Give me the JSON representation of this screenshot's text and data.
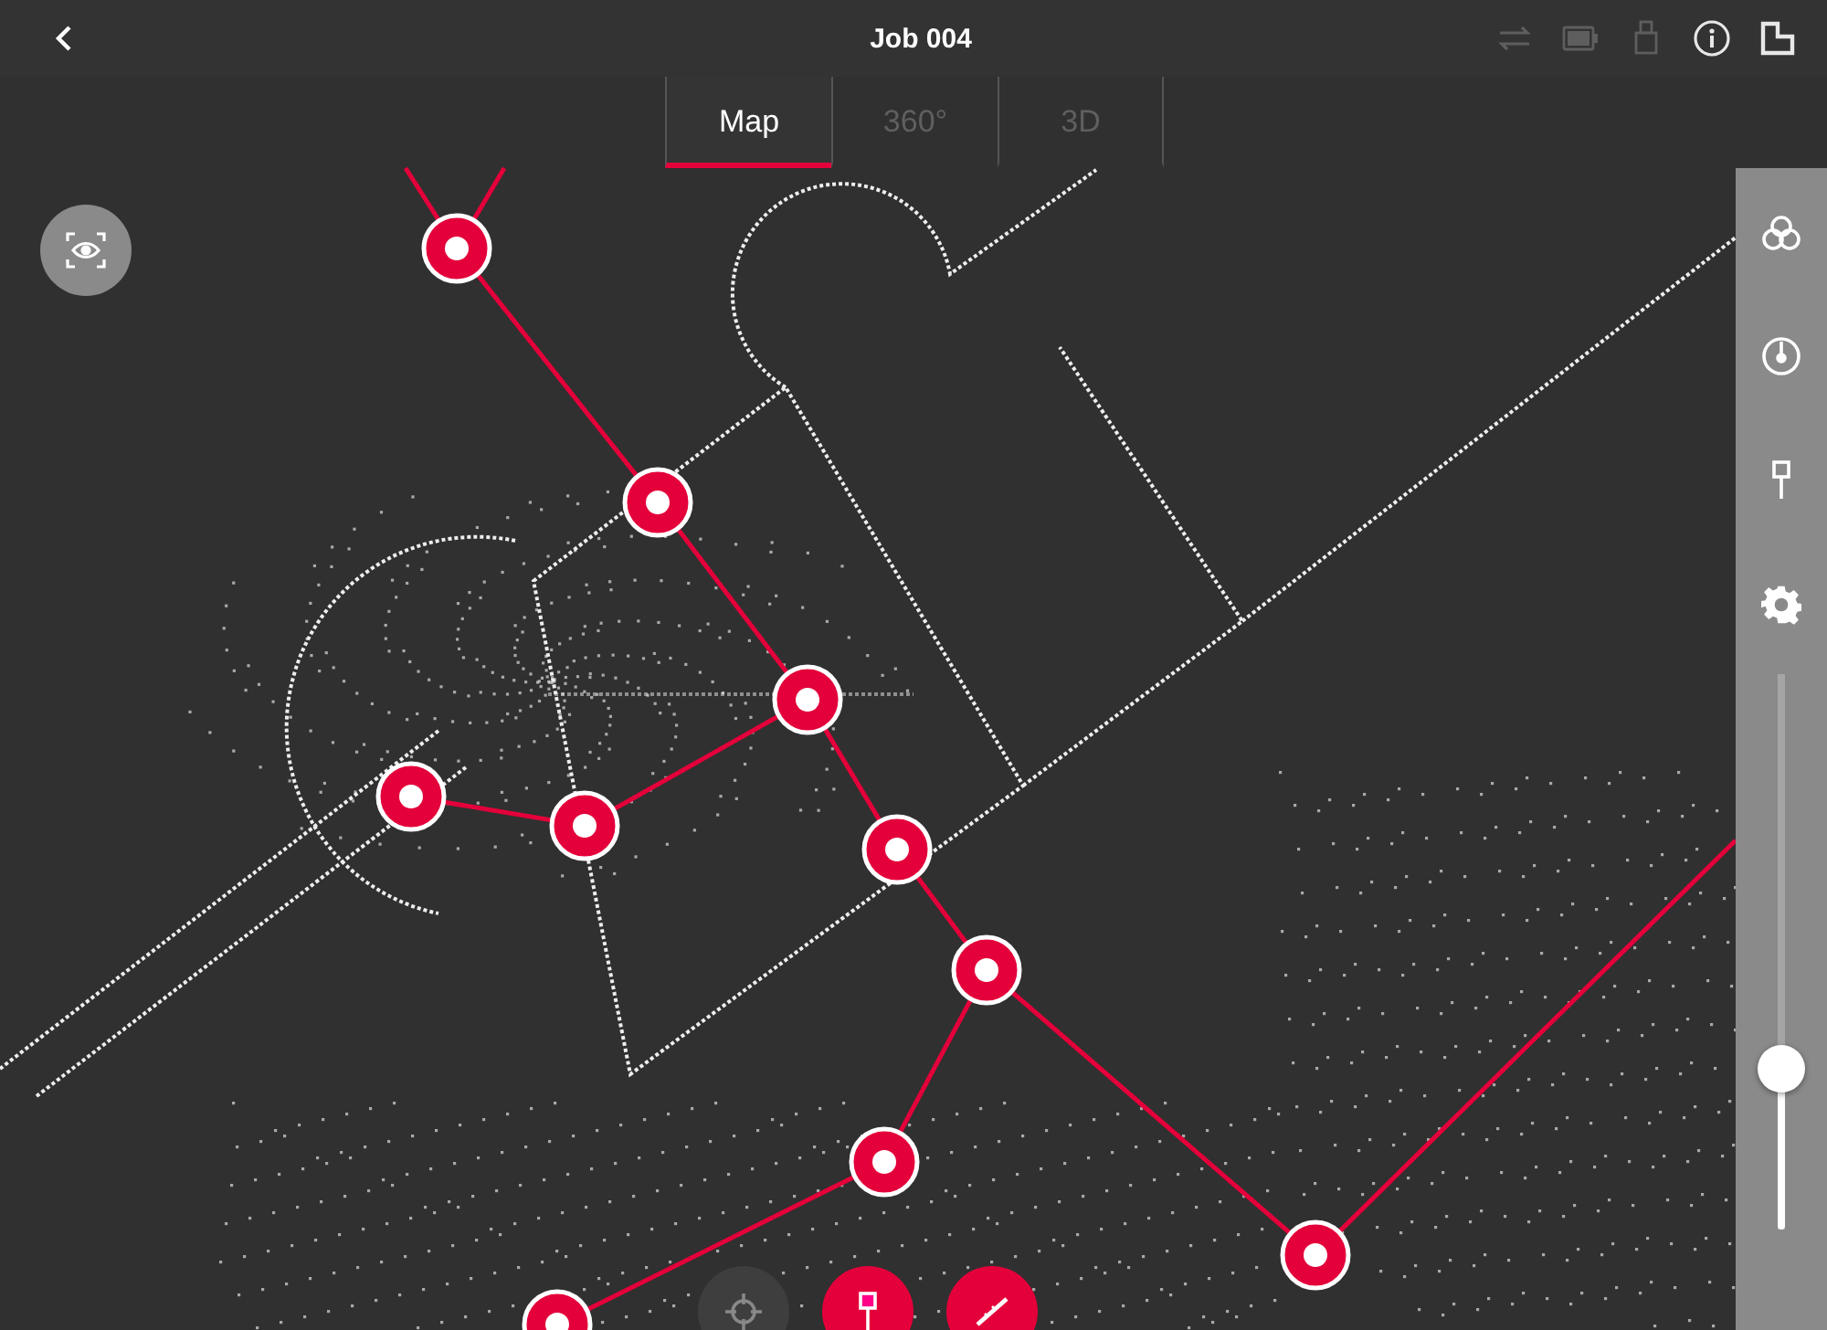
{
  "header": {
    "title": "Job 004",
    "icons": [
      {
        "kind": "sync",
        "active": false
      },
      {
        "kind": "battery",
        "active": false
      },
      {
        "kind": "usb",
        "active": false
      },
      {
        "kind": "info",
        "active": true
      },
      {
        "kind": "floorplan",
        "active": true
      }
    ]
  },
  "tabs": [
    {
      "label": "Map",
      "selected": true
    },
    {
      "label": "360°",
      "selected": false
    },
    {
      "label": "3D",
      "selected": false
    }
  ],
  "sidebar": {
    "tools": [
      {
        "kind": "layers"
      },
      {
        "kind": "dial"
      },
      {
        "kind": "pin"
      },
      {
        "kind": "settings"
      }
    ],
    "slider": {
      "level": 0.29
    }
  },
  "bottom_actions": [
    {
      "kind": "locate",
      "primary": false
    },
    {
      "kind": "pin",
      "primary": true
    },
    {
      "kind": "measure",
      "primary": true
    }
  ]
}
